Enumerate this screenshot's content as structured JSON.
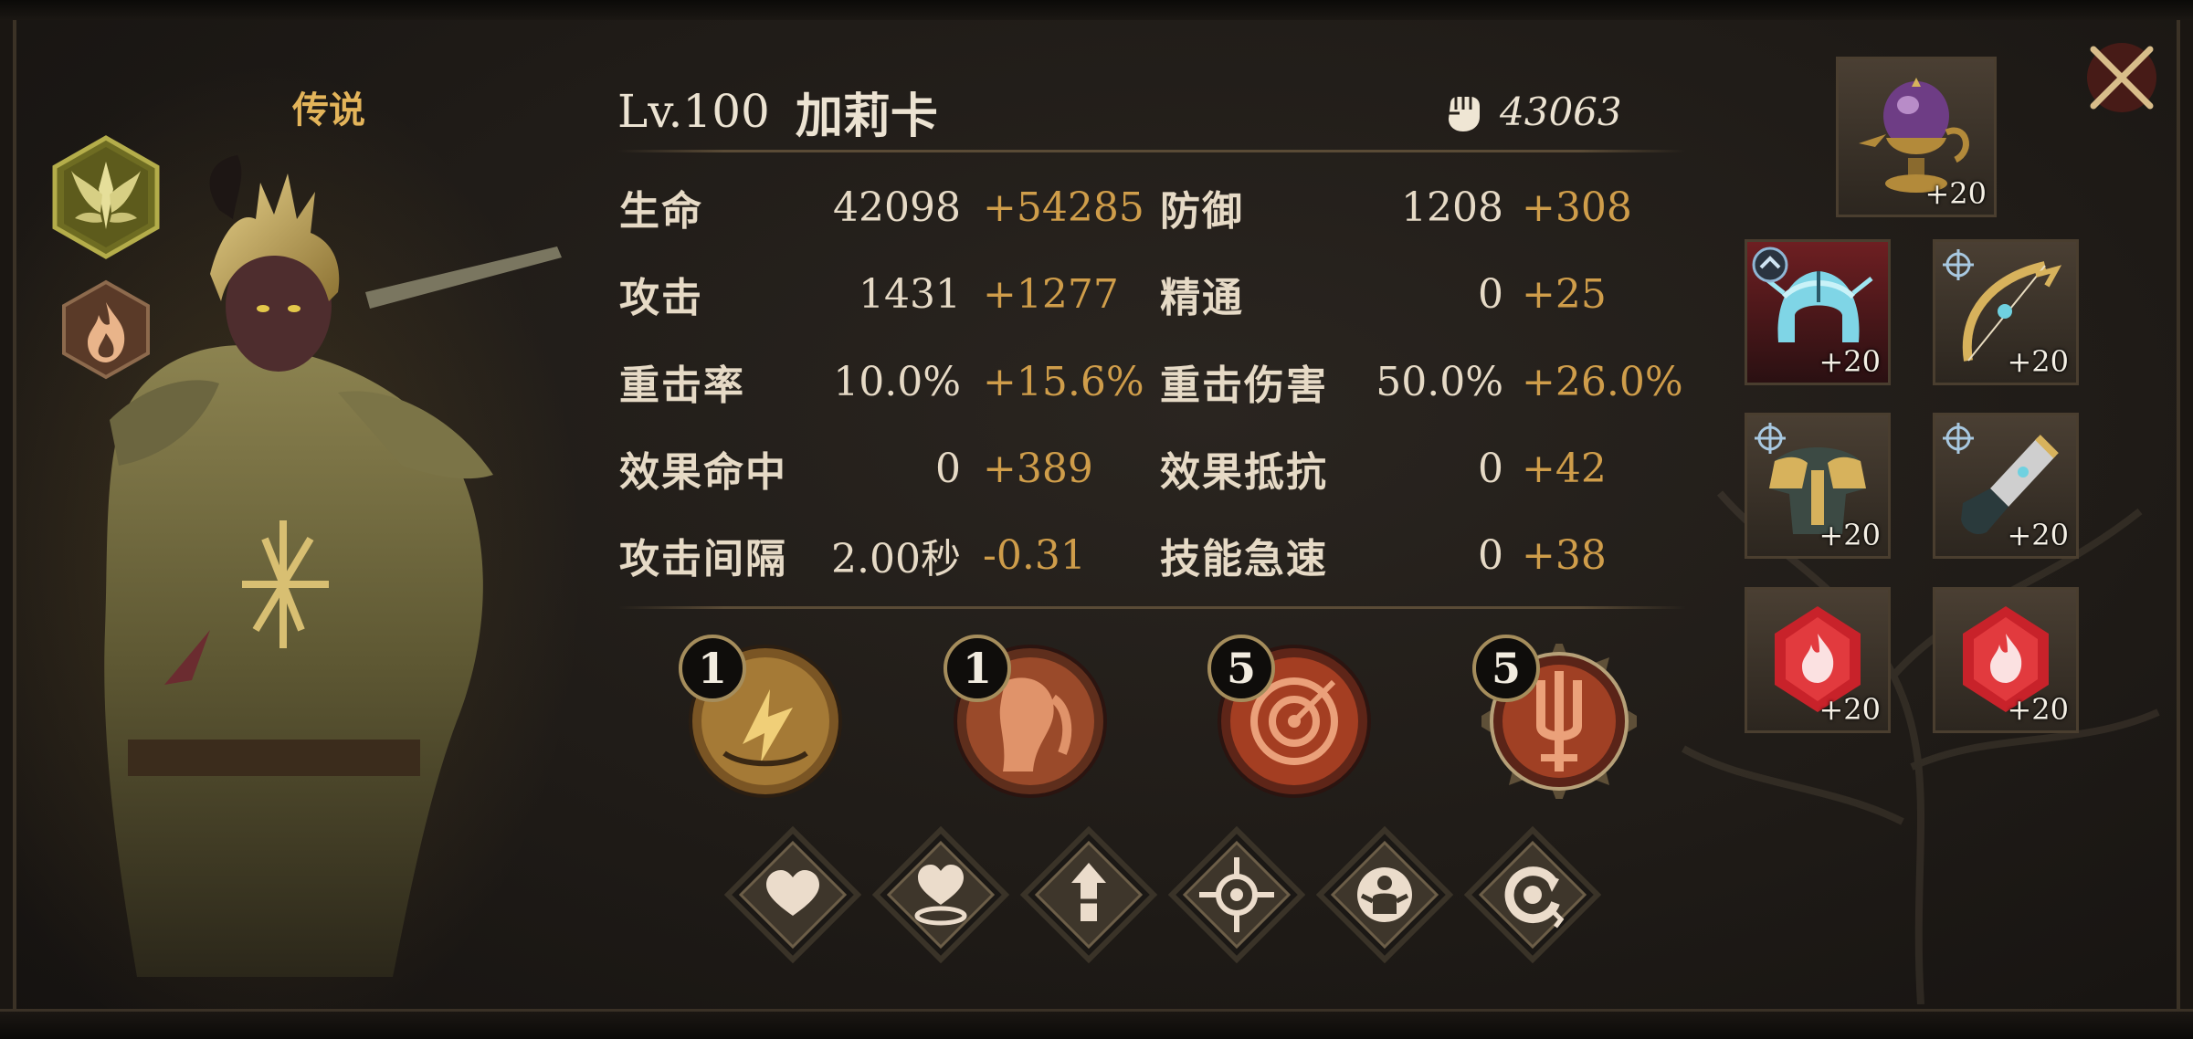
{
  "hero": {
    "rarity": "传说",
    "level": "Lv.100",
    "name": "加莉卡",
    "power": "43063",
    "class_icon": "winged-crest-icon",
    "element_icon": "fire-icon"
  },
  "stats": [
    {
      "label": "生命",
      "base": "42098",
      "bonus": "+54285"
    },
    {
      "label": "防御",
      "base": "1208",
      "bonus": "+308"
    },
    {
      "label": "攻击",
      "base": "1431",
      "bonus": "+1277"
    },
    {
      "label": "精通",
      "base": "0",
      "bonus": "+25"
    },
    {
      "label": "重击率",
      "base": "10.0%",
      "bonus": "+15.6%"
    },
    {
      "label": "重击伤害",
      "base": "50.0%",
      "bonus": "+26.0%"
    },
    {
      "label": "效果命中",
      "base": "0",
      "bonus": "+389"
    },
    {
      "label": "效果抵抗",
      "base": "0",
      "bonus": "+42"
    },
    {
      "label": "攻击间隔",
      "base": "2.00秒",
      "bonus": "-0.31"
    },
    {
      "label": "技能急速",
      "base": "0",
      "bonus": "+38"
    }
  ],
  "skills": [
    {
      "level": "1",
      "icon": "lightning-bolt-skill-icon"
    },
    {
      "level": "1",
      "icon": "warrior-portrait-skill-icon"
    },
    {
      "level": "5",
      "icon": "target-burst-skill-icon"
    },
    {
      "level": "5",
      "icon": "trident-ultimate-skill-icon"
    }
  ],
  "talents": [
    {
      "icon": "heart-icon"
    },
    {
      "icon": "heart-shield-icon"
    },
    {
      "icon": "sword-up-icon"
    },
    {
      "icon": "crosshair-icon"
    },
    {
      "icon": "guardian-icon"
    },
    {
      "icon": "cycle-icon"
    }
  ],
  "equipment": [
    {
      "slot": "artifact",
      "level": "+20",
      "icon": "lamp-artifact-icon"
    },
    {
      "slot": "helmet",
      "level": "+20",
      "icon": "ice-helmet-icon"
    },
    {
      "slot": "weapon",
      "level": "+20",
      "icon": "golden-bow-icon"
    },
    {
      "slot": "armor",
      "level": "+20",
      "icon": "golden-armor-icon"
    },
    {
      "slot": "gloves",
      "level": "+20",
      "icon": "gauntlet-icon"
    },
    {
      "slot": "gem-1",
      "level": "+20",
      "icon": "fire-gem-icon"
    },
    {
      "slot": "gem-2",
      "level": "+20",
      "icon": "fire-gem-icon"
    }
  ],
  "colors": {
    "text": "#ece3d2",
    "bonus": "#cf9d4a",
    "rarity": "#e3b45a"
  }
}
